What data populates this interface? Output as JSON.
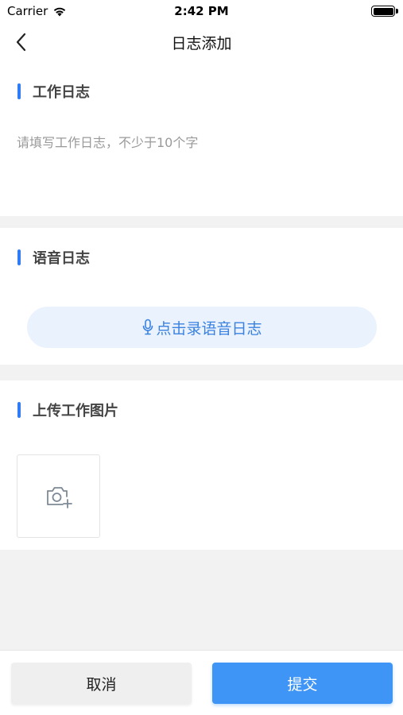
{
  "status_bar": {
    "carrier": "Carrier",
    "time": "2:42 PM",
    "wifi_icon": "wifi-icon",
    "battery_icon": "battery-full-icon"
  },
  "nav": {
    "title": "日志添加",
    "back_icon": "chevron-left-icon"
  },
  "work_log": {
    "title": "工作日志",
    "value": "",
    "placeholder": "请填写工作日志，不少于10个字"
  },
  "voice_log": {
    "title": "语音日志",
    "button_label": "点击录语音日志",
    "button_icon": "microphone-icon"
  },
  "images": {
    "title": "上传工作图片",
    "add_icon": "camera-add-icon"
  },
  "footer": {
    "cancel_label": "取消",
    "submit_label": "提交"
  },
  "colors": {
    "accent": "#2f7cf6",
    "submit_bg": "#3f95f6",
    "voice_bg": "#e9f2fd",
    "voice_text": "#3b82e0",
    "page_bg": "#f2f2f2"
  }
}
